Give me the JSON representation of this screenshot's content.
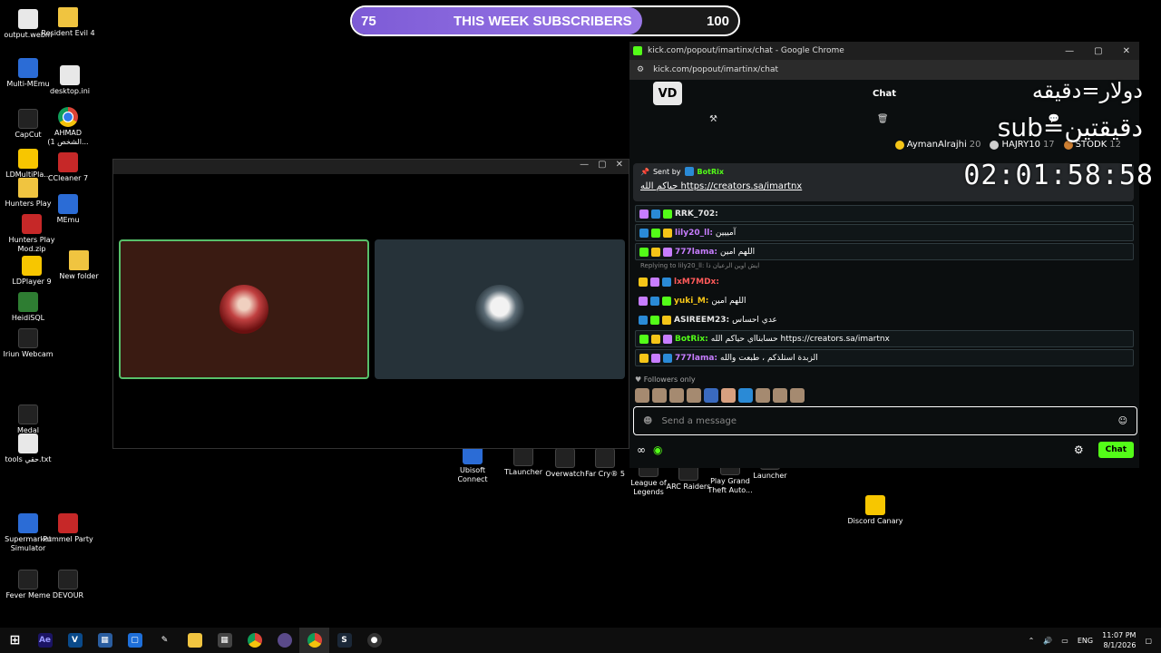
{
  "desktop_icons": [
    {
      "label": "output.webm",
      "icon": "doc"
    },
    {
      "label": "Resident Evil 4",
      "icon": "folder"
    },
    {
      "label": "Multi-MEmu",
      "icon": "blue"
    },
    {
      "label": "desktop.ini",
      "icon": "doc"
    },
    {
      "label": "CapCut",
      "icon": "dark"
    },
    {
      "label": "AHMAD (الشخص 1...",
      "icon": "chrome"
    },
    {
      "label": "LDMultiPla...",
      "icon": "yellow"
    },
    {
      "label": "CCleaner 7",
      "icon": "red"
    },
    {
      "label": "Hunters Play",
      "icon": "folder"
    },
    {
      "label": "MEmu",
      "icon": "blue"
    },
    {
      "label": "Hunters Play Mod.zip",
      "icon": "red"
    },
    {
      "label": "LDPlayer 9",
      "icon": "yellow"
    },
    {
      "label": "New folder",
      "icon": "folder"
    },
    {
      "label": "HeidiSQL",
      "icon": "green"
    },
    {
      "label": "Iriun Webcam",
      "icon": "dark"
    },
    {
      "label": "Medal",
      "icon": "dark"
    },
    {
      "label": "tools حقي.txt",
      "icon": "doc"
    },
    {
      "label": "Supermarket Simulator",
      "icon": "blue"
    },
    {
      "label": "Pummel Party",
      "icon": "red"
    },
    {
      "label": "Fever Meme",
      "icon": "dark"
    },
    {
      "label": "DEVOUR",
      "icon": "dark"
    },
    {
      "label": "Ubisoft Connect",
      "icon": "blue"
    },
    {
      "label": "TLauncher",
      "icon": "dark"
    },
    {
      "label": "Overwatch",
      "icon": "dark"
    },
    {
      "label": "Far Cry® 5",
      "icon": "dark"
    },
    {
      "label": "League of Legends",
      "icon": "dark"
    },
    {
      "label": "ARC Raiders",
      "icon": "dark"
    },
    {
      "label": "Play Grand Theft Auto...",
      "icon": "dark"
    },
    {
      "label": "Launcher",
      "icon": "dark"
    },
    {
      "label": "Discord Canary",
      "icon": "yellow"
    }
  ],
  "sub_goal": {
    "current": "75",
    "label": "THIS WEEK SUBSCRIBERS",
    "target": "100",
    "progress": 0.75
  },
  "meeting_window": {
    "controls": [
      "—",
      "▢",
      "✕"
    ]
  },
  "chrome": {
    "title": "kick.com/popout/imartinx/chat - Google Chrome",
    "url": "kick.com/popout/imartinx/chat",
    "win_controls": [
      "—",
      "▢",
      "✕"
    ]
  },
  "chat": {
    "header": "Chat",
    "logo": "VD",
    "gifters": [
      {
        "name": "AymanAlrajhi",
        "count": "20",
        "color": "#f5c518"
      },
      {
        "name": "HAJRY10",
        "count": "17",
        "color": "#cfcfcf"
      },
      {
        "name": "STODK",
        "count": "12",
        "color": "#cd7f32"
      }
    ],
    "pinned": {
      "sent_by_label": "Sent by",
      "sender": "BotRix",
      "prefix": "حياكم الله",
      "link": "https://creators.sa/imartnx"
    },
    "messages": [
      {
        "user": "RRK_702:",
        "text": "",
        "color": "#e6e6e6",
        "hl": true
      },
      {
        "user": "lily20_ll:",
        "text": "آمييين",
        "color": "#c77dff",
        "hl": true
      },
      {
        "user": "777lama:",
        "text": "اللهم امين",
        "color": "#c77dff",
        "hl": true
      },
      {
        "user": "lxM7MDx:",
        "text": "",
        "color": "#ff5a5a",
        "hl": false
      },
      {
        "user": "yuki_M:",
        "text": "اللهم امين",
        "color": "#f5c518",
        "hl": false
      },
      {
        "user": "ASIREEM23:",
        "text": "عدي احساس",
        "color": "#e6e6e6",
        "hl": false
      },
      {
        "user": "BotRix:",
        "text": "حسابنااي حياكم الله https://creators.sa/imartnx",
        "color": "#53fc18",
        "hl": true
      },
      {
        "user": "777lama:",
        "text": "الزبدة استلذكم ، طبعت والله",
        "color": "#c77dff",
        "hl": true
      }
    ],
    "reply_note": "Replying to lily20_ll: ايش اوين الرعيان ذا",
    "followers_only": "Followers only",
    "input_placeholder": "Send a message",
    "send_button": "Chat"
  },
  "overlay": {
    "line1": "دولار=دقيقه",
    "line2": "sub=دقيقتين",
    "timer": "02:01:58:58"
  },
  "tray": {
    "lang": "ENG",
    "time": "11:07 PM",
    "date": "8/1/2026"
  }
}
